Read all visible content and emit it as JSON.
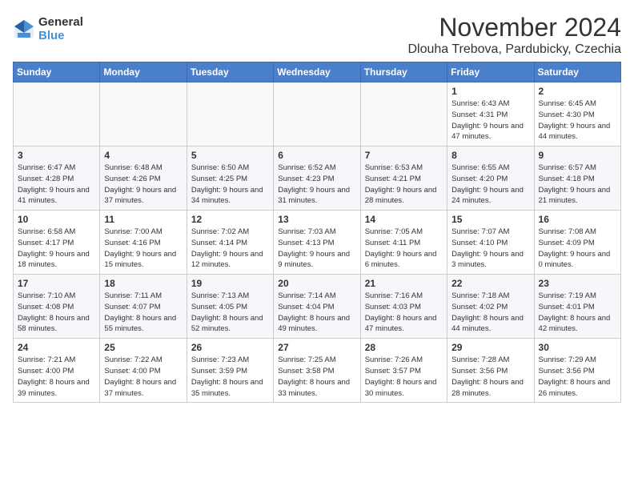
{
  "header": {
    "logo_general": "General",
    "logo_blue": "Blue",
    "month_title": "November 2024",
    "location": "Dlouha Trebova, Pardubicky, Czechia"
  },
  "weekdays": [
    "Sunday",
    "Monday",
    "Tuesday",
    "Wednesday",
    "Thursday",
    "Friday",
    "Saturday"
  ],
  "weeks": [
    [
      {
        "day": "",
        "info": ""
      },
      {
        "day": "",
        "info": ""
      },
      {
        "day": "",
        "info": ""
      },
      {
        "day": "",
        "info": ""
      },
      {
        "day": "",
        "info": ""
      },
      {
        "day": "1",
        "info": "Sunrise: 6:43 AM\nSunset: 4:31 PM\nDaylight: 9 hours and 47 minutes."
      },
      {
        "day": "2",
        "info": "Sunrise: 6:45 AM\nSunset: 4:30 PM\nDaylight: 9 hours and 44 minutes."
      }
    ],
    [
      {
        "day": "3",
        "info": "Sunrise: 6:47 AM\nSunset: 4:28 PM\nDaylight: 9 hours and 41 minutes."
      },
      {
        "day": "4",
        "info": "Sunrise: 6:48 AM\nSunset: 4:26 PM\nDaylight: 9 hours and 37 minutes."
      },
      {
        "day": "5",
        "info": "Sunrise: 6:50 AM\nSunset: 4:25 PM\nDaylight: 9 hours and 34 minutes."
      },
      {
        "day": "6",
        "info": "Sunrise: 6:52 AM\nSunset: 4:23 PM\nDaylight: 9 hours and 31 minutes."
      },
      {
        "day": "7",
        "info": "Sunrise: 6:53 AM\nSunset: 4:21 PM\nDaylight: 9 hours and 28 minutes."
      },
      {
        "day": "8",
        "info": "Sunrise: 6:55 AM\nSunset: 4:20 PM\nDaylight: 9 hours and 24 minutes."
      },
      {
        "day": "9",
        "info": "Sunrise: 6:57 AM\nSunset: 4:18 PM\nDaylight: 9 hours and 21 minutes."
      }
    ],
    [
      {
        "day": "10",
        "info": "Sunrise: 6:58 AM\nSunset: 4:17 PM\nDaylight: 9 hours and 18 minutes."
      },
      {
        "day": "11",
        "info": "Sunrise: 7:00 AM\nSunset: 4:16 PM\nDaylight: 9 hours and 15 minutes."
      },
      {
        "day": "12",
        "info": "Sunrise: 7:02 AM\nSunset: 4:14 PM\nDaylight: 9 hours and 12 minutes."
      },
      {
        "day": "13",
        "info": "Sunrise: 7:03 AM\nSunset: 4:13 PM\nDaylight: 9 hours and 9 minutes."
      },
      {
        "day": "14",
        "info": "Sunrise: 7:05 AM\nSunset: 4:11 PM\nDaylight: 9 hours and 6 minutes."
      },
      {
        "day": "15",
        "info": "Sunrise: 7:07 AM\nSunset: 4:10 PM\nDaylight: 9 hours and 3 minutes."
      },
      {
        "day": "16",
        "info": "Sunrise: 7:08 AM\nSunset: 4:09 PM\nDaylight: 9 hours and 0 minutes."
      }
    ],
    [
      {
        "day": "17",
        "info": "Sunrise: 7:10 AM\nSunset: 4:08 PM\nDaylight: 8 hours and 58 minutes."
      },
      {
        "day": "18",
        "info": "Sunrise: 7:11 AM\nSunset: 4:07 PM\nDaylight: 8 hours and 55 minutes."
      },
      {
        "day": "19",
        "info": "Sunrise: 7:13 AM\nSunset: 4:05 PM\nDaylight: 8 hours and 52 minutes."
      },
      {
        "day": "20",
        "info": "Sunrise: 7:14 AM\nSunset: 4:04 PM\nDaylight: 8 hours and 49 minutes."
      },
      {
        "day": "21",
        "info": "Sunrise: 7:16 AM\nSunset: 4:03 PM\nDaylight: 8 hours and 47 minutes."
      },
      {
        "day": "22",
        "info": "Sunrise: 7:18 AM\nSunset: 4:02 PM\nDaylight: 8 hours and 44 minutes."
      },
      {
        "day": "23",
        "info": "Sunrise: 7:19 AM\nSunset: 4:01 PM\nDaylight: 8 hours and 42 minutes."
      }
    ],
    [
      {
        "day": "24",
        "info": "Sunrise: 7:21 AM\nSunset: 4:00 PM\nDaylight: 8 hours and 39 minutes."
      },
      {
        "day": "25",
        "info": "Sunrise: 7:22 AM\nSunset: 4:00 PM\nDaylight: 8 hours and 37 minutes."
      },
      {
        "day": "26",
        "info": "Sunrise: 7:23 AM\nSunset: 3:59 PM\nDaylight: 8 hours and 35 minutes."
      },
      {
        "day": "27",
        "info": "Sunrise: 7:25 AM\nSunset: 3:58 PM\nDaylight: 8 hours and 33 minutes."
      },
      {
        "day": "28",
        "info": "Sunrise: 7:26 AM\nSunset: 3:57 PM\nDaylight: 8 hours and 30 minutes."
      },
      {
        "day": "29",
        "info": "Sunrise: 7:28 AM\nSunset: 3:56 PM\nDaylight: 8 hours and 28 minutes."
      },
      {
        "day": "30",
        "info": "Sunrise: 7:29 AM\nSunset: 3:56 PM\nDaylight: 8 hours and 26 minutes."
      }
    ]
  ]
}
